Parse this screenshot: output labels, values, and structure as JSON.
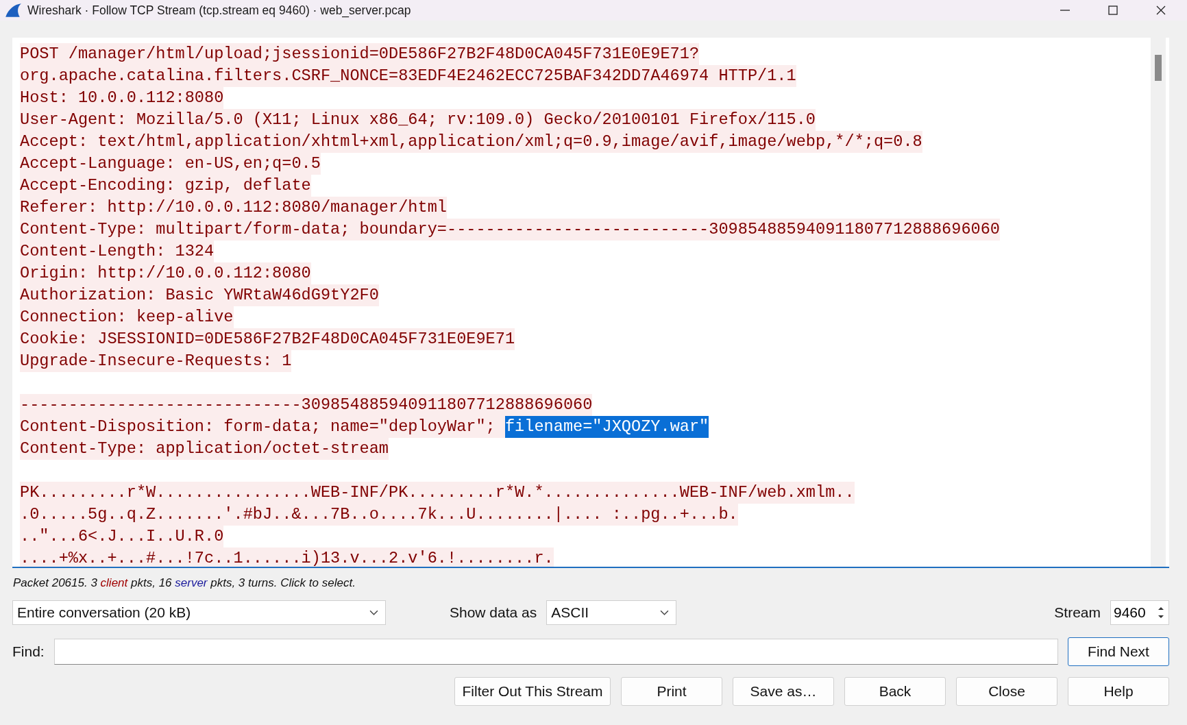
{
  "window": {
    "title": "Wireshark · Follow TCP Stream (tcp.stream eq 9460) · web_server.pcap"
  },
  "stream_text": {
    "lines": [
      {
        "kind": "client",
        "segments": [
          {
            "text": "POST /manager/html/upload;jsessionid=0DE586F27B2F48D0CA045F731E0E9E71?",
            "selected": false
          }
        ]
      },
      {
        "kind": "client",
        "segments": [
          {
            "text": "org.apache.catalina.filters.CSRF_NONCE=83EDF4E2462ECC725BAF342DD7A46974 HTTP/1.1",
            "selected": false
          }
        ]
      },
      {
        "kind": "client",
        "segments": [
          {
            "text": "Host: 10.0.0.112:8080",
            "selected": false
          }
        ]
      },
      {
        "kind": "client",
        "segments": [
          {
            "text": "User-Agent: Mozilla/5.0 (X11; Linux x86_64; rv:109.0) Gecko/20100101 Firefox/115.0",
            "selected": false
          }
        ]
      },
      {
        "kind": "client",
        "segments": [
          {
            "text": "Accept: text/html,application/xhtml+xml,application/xml;q=0.9,image/avif,image/webp,*/*;q=0.8",
            "selected": false
          }
        ]
      },
      {
        "kind": "client",
        "segments": [
          {
            "text": "Accept-Language: en-US,en;q=0.5",
            "selected": false
          }
        ]
      },
      {
        "kind": "client",
        "segments": [
          {
            "text": "Accept-Encoding: gzip, deflate",
            "selected": false
          }
        ]
      },
      {
        "kind": "client",
        "segments": [
          {
            "text": "Referer: http://10.0.0.112:8080/manager/html",
            "selected": false
          }
        ]
      },
      {
        "kind": "client",
        "segments": [
          {
            "text": "Content-Type: multipart/form-data; boundary=---------------------------309854885940911807712888696060",
            "selected": false
          }
        ]
      },
      {
        "kind": "client",
        "segments": [
          {
            "text": "Content-Length: 1324",
            "selected": false
          }
        ]
      },
      {
        "kind": "client",
        "segments": [
          {
            "text": "Origin: http://10.0.0.112:8080",
            "selected": false
          }
        ]
      },
      {
        "kind": "client",
        "segments": [
          {
            "text": "Authorization: Basic YWRtaW46dG9tY2F0",
            "selected": false
          }
        ]
      },
      {
        "kind": "client",
        "segments": [
          {
            "text": "Connection: keep-alive",
            "selected": false
          }
        ]
      },
      {
        "kind": "client",
        "segments": [
          {
            "text": "Cookie: JSESSIONID=0DE586F27B2F48D0CA045F731E0E9E71",
            "selected": false
          }
        ]
      },
      {
        "kind": "client",
        "segments": [
          {
            "text": "Upgrade-Insecure-Requests: 1",
            "selected": false
          }
        ]
      },
      {
        "kind": "blank"
      },
      {
        "kind": "client",
        "segments": [
          {
            "text": "-----------------------------309854885940911807712888696060",
            "selected": false
          }
        ]
      },
      {
        "kind": "client",
        "segments": [
          {
            "text": "Content-Disposition: form-data; name=\"deployWar\"; ",
            "selected": false
          },
          {
            "text": "filename=\"JXQOZY.war\"",
            "selected": true
          }
        ]
      },
      {
        "kind": "client",
        "segments": [
          {
            "text": "Content-Type: application/octet-stream",
            "selected": false
          }
        ]
      },
      {
        "kind": "blank"
      },
      {
        "kind": "client",
        "segments": [
          {
            "text": "PK.........r*W................WEB-INF/PK.........r*W.*..............WEB-INF/web.xmlm..",
            "selected": false
          }
        ]
      },
      {
        "kind": "client",
        "segments": [
          {
            "text": ".0.....5g..q.Z.......'.#bJ..&...7B..o....7k...U........|.... :..pg..+...b.",
            "selected": false
          }
        ]
      },
      {
        "kind": "client",
        "segments": [
          {
            "text": "..\"...6<.J...I..U.R.0",
            "selected": false
          }
        ]
      },
      {
        "kind": "client",
        "segments": [
          {
            "text": "....+%x..+...#...!7c..1......i)13.v...2.v'6.!........r.",
            "selected": false
          }
        ]
      }
    ]
  },
  "status_bar": {
    "parts": [
      {
        "kind": "plain",
        "text": "Packet 20615. 3 "
      },
      {
        "kind": "client",
        "text": "client"
      },
      {
        "kind": "plain",
        "text": " pkts, 16 "
      },
      {
        "kind": "server",
        "text": "server"
      },
      {
        "kind": "plain",
        "text": " pkts, 3 turns. Click to select."
      }
    ]
  },
  "conversation_select": {
    "value": "Entire conversation (20 kB)"
  },
  "show_data_as": {
    "label": "Show data as",
    "value": "ASCII"
  },
  "stream": {
    "label": "Stream",
    "value": "9460"
  },
  "find": {
    "label": "Find:",
    "button": "Find Next"
  },
  "buttons": [
    "Filter Out This Stream",
    "Print",
    "Save as…",
    "Back",
    "Close",
    "Help"
  ]
}
